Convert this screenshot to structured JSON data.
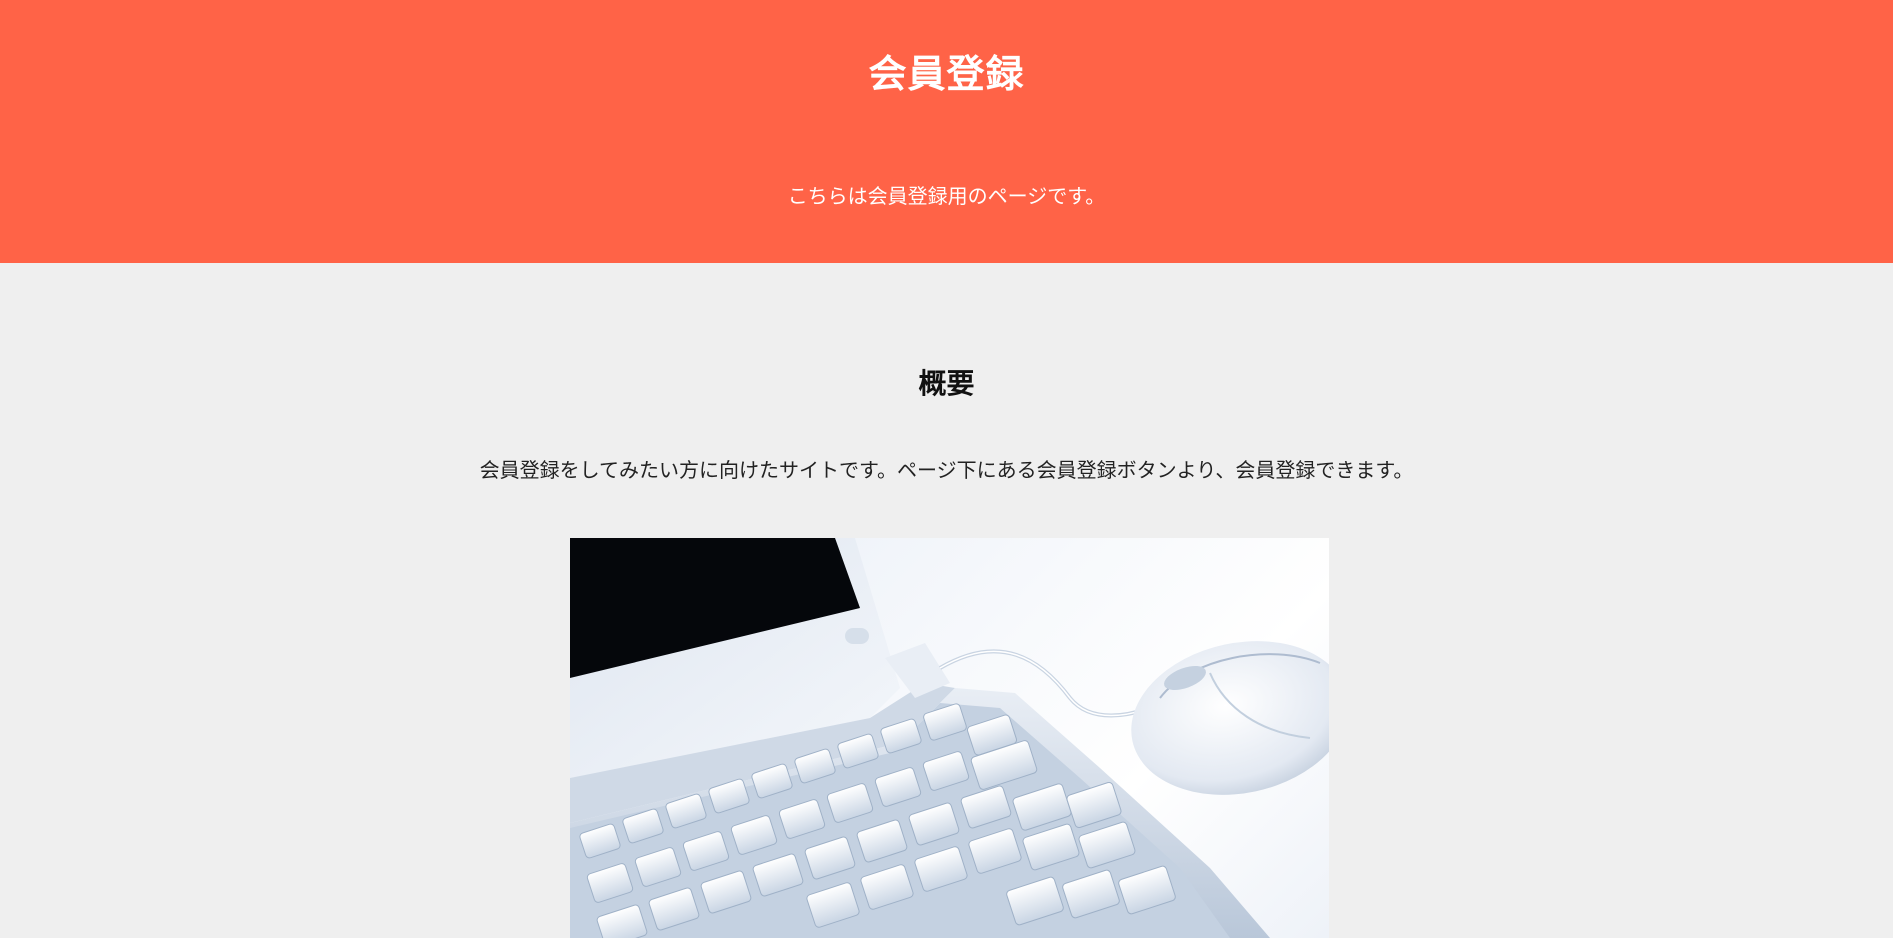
{
  "header": {
    "title": "会員登録",
    "subtitle": "こちらは会員登録用のページです。",
    "background_color": "#ff6347"
  },
  "overview": {
    "heading": "概要",
    "description": "会員登録をしてみたい方に向けたサイトです。ページ下にある会員登録ボタンより、会員登録できます。"
  },
  "hero_image": {
    "icon": "laptop-with-mouse-photo"
  }
}
